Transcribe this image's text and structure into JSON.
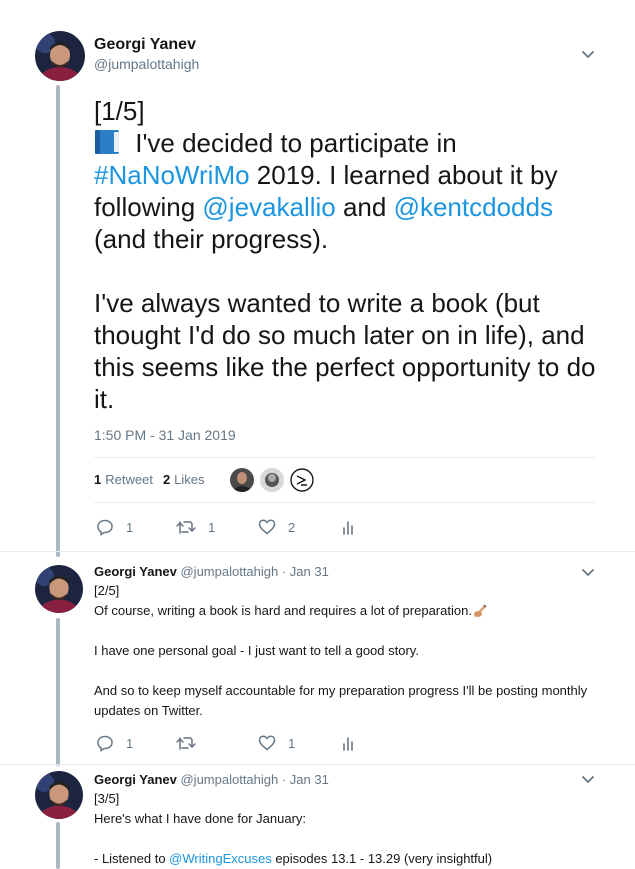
{
  "main_tweet": {
    "author": "Georgi Yanev",
    "handle": "@jumpalottahigh",
    "line1": "[1/5]",
    "text_a": " I've decided to participate in ",
    "hashtag": "#NaNoWriMo",
    "text_b": " 2019. I learned about it by following ",
    "mention1": "@jevakallio",
    "text_c": " and ",
    "mention2": "@kentcdodds",
    "text_d": " (and their progress).",
    "paragraph2": "I've always wanted to write a book (but thought I'd do so much later on in life), and this seems like the perfect opportunity to do it.",
    "timestamp": "1:50 PM - 31 Jan 2019",
    "retweets_count": "1",
    "retweets_label": "Retweet",
    "likes_count": "2",
    "likes_label": "Likes",
    "actions": {
      "replies": "1",
      "retweets": "1",
      "likes": "2"
    }
  },
  "reply1": {
    "author": "Georgi Yanev",
    "meta": "@jumpalottahigh · Jan 31",
    "line1": "[2/5]",
    "line2": "Of course, writing a book is hard and requires a lot of preparation.",
    "line3": "I have one personal goal - I just want to tell a good story.",
    "line4": "And so to keep myself accountable for my preparation progress I'll be posting monthly updates on Twitter.",
    "actions": {
      "replies": "1",
      "retweets": "",
      "likes": "1"
    }
  },
  "reply2": {
    "author": "Georgi Yanev",
    "meta": "@jumpalottahigh · Jan 31",
    "line1": "[3/5]",
    "line2": "Here's what I have done for January:",
    "line3_pre": "- Listened to ",
    "line3_mention": "@WritingExcuses",
    "line3_post": " episodes 13.1 - 13.29 (very insightful)"
  },
  "icons": [
    "chevron-down-icon",
    "reply-icon",
    "retweet-icon",
    "heart-icon",
    "analytics-icon",
    "book-emoji",
    "writing-hand-emoji"
  ],
  "colors": {
    "link": "#1b95e0",
    "muted": "#657786",
    "thread_line": "#aab8c2",
    "text": "#14171a"
  }
}
